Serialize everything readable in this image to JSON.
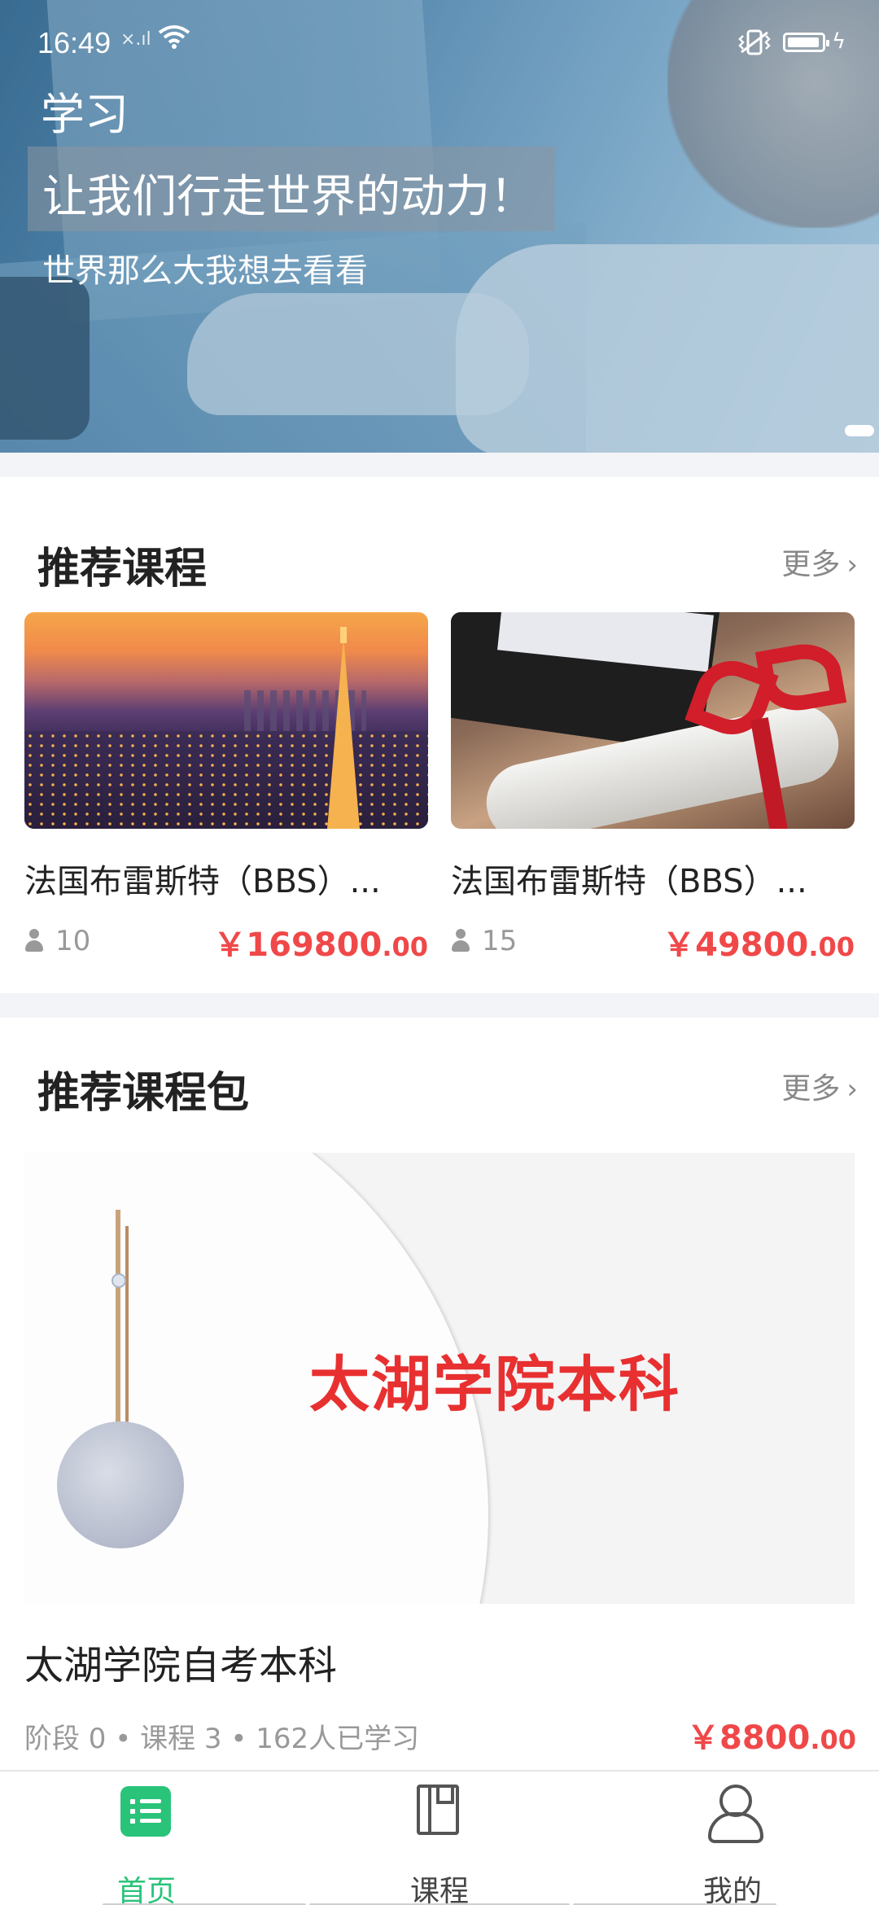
{
  "status_bar": {
    "time": "16:49",
    "signal_text": "×.ıl",
    "icons": [
      "wifi-icon",
      "vibrate-icon",
      "battery-icon",
      "charging-icon"
    ]
  },
  "hero": {
    "title": "学习",
    "slogan": "让我们行走世界的动力！",
    "subslogan": "世界那么大我想去看看"
  },
  "recommended_courses": {
    "title": "推荐课程",
    "more_label": "更多",
    "items": [
      {
        "title": "法国布雷斯特（BBS）...",
        "students": "10",
        "price_int": "￥169800",
        "price_dec": ".00",
        "image": "paris-eiffel-tower-image"
      },
      {
        "title": "法国布雷斯特（BBS）...",
        "students": "15",
        "price_int": "￥49800",
        "price_dec": ".00",
        "image": "graduation-diploma-image"
      }
    ]
  },
  "recommended_packages": {
    "title": "推荐课程包",
    "more_label": "更多",
    "item": {
      "image_text": "太湖学院本科",
      "title": "太湖学院自考本科",
      "meta": "阶段 0 • 课程 3 • 162人已学习",
      "price_int": "￥8800",
      "price_dec": ".00"
    }
  },
  "bottom_nav": {
    "active_color": "#2ac37a",
    "tabs": [
      {
        "label": "首页",
        "icon": "home-list-icon",
        "active": true
      },
      {
        "label": "课程",
        "icon": "book-icon",
        "active": false
      },
      {
        "label": "我的",
        "icon": "user-icon",
        "active": false
      }
    ]
  }
}
